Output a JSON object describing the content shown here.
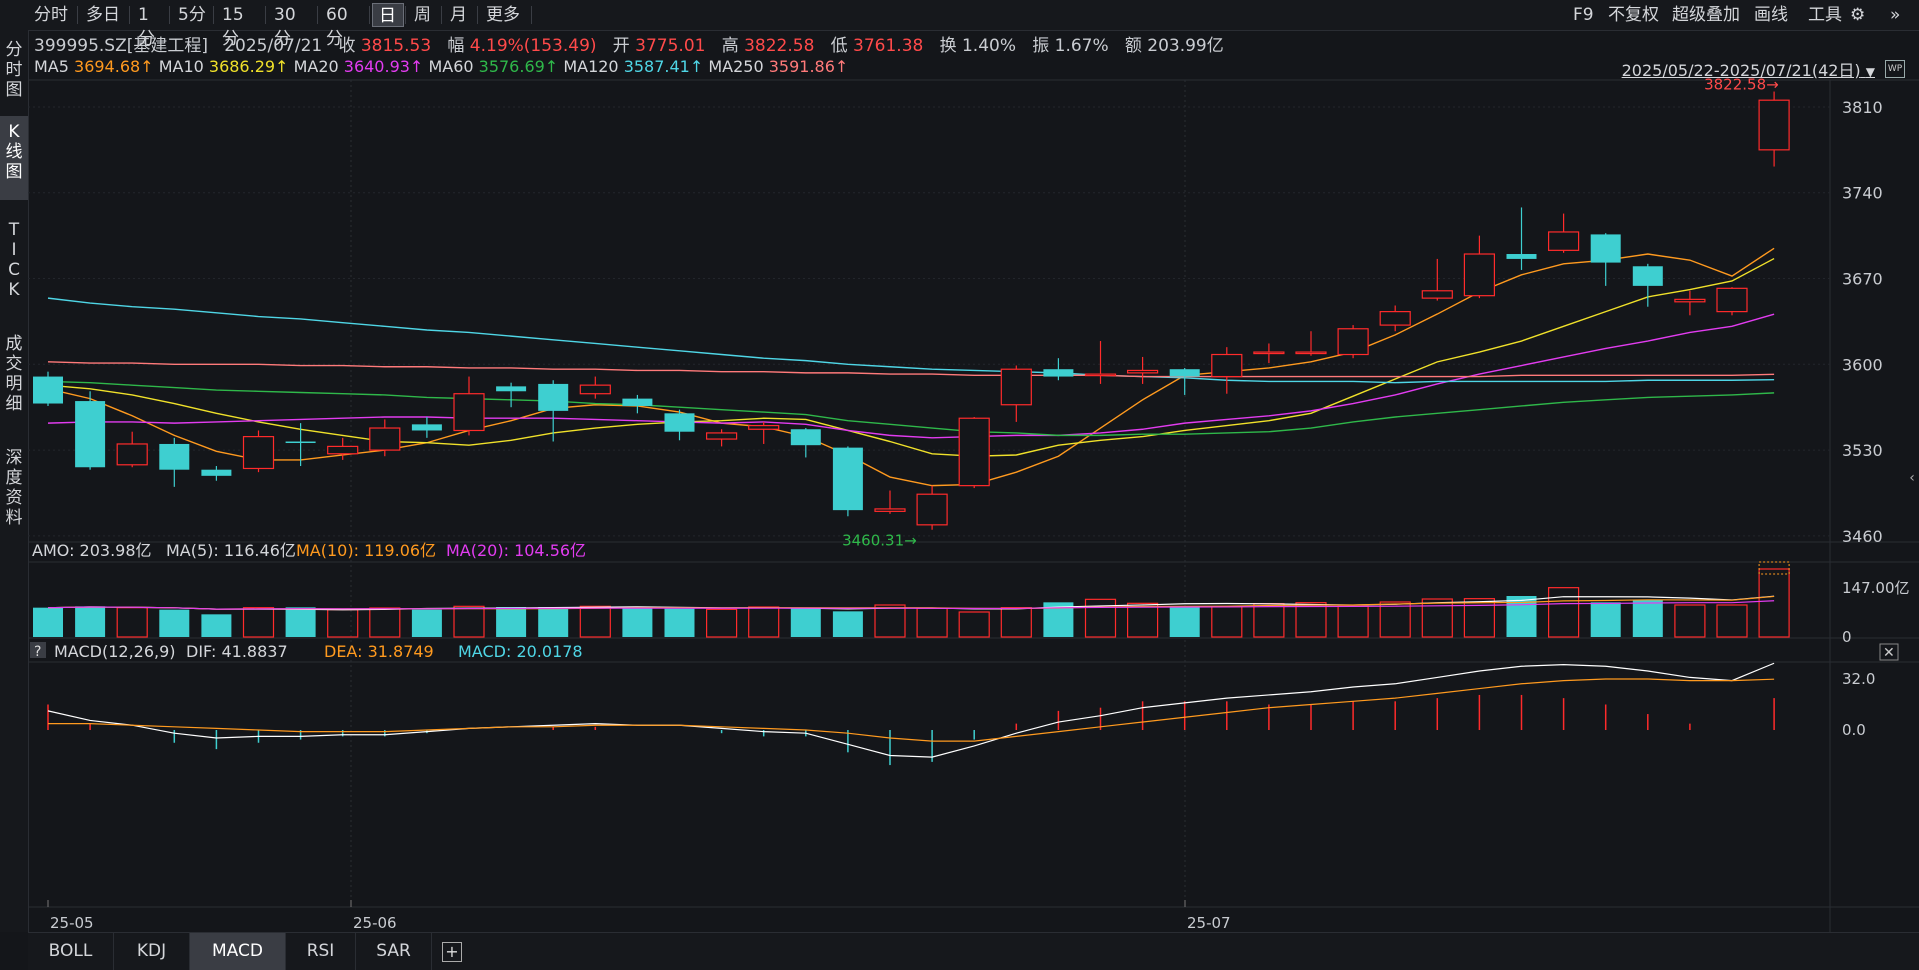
{
  "toolbar": {
    "periods": [
      "分时",
      "多日",
      "1分",
      "5分",
      "15分",
      "30分",
      "60分",
      "日",
      "周",
      "月",
      "更多"
    ],
    "active_period": "日",
    "right_items": [
      "F9",
      "不复权",
      "超级叠加",
      "画线",
      "工具"
    ],
    "settings_icon": "gear-icon",
    "collapse_icon": "double-chevron-right-icon"
  },
  "left_tabs": [
    {
      "label": "分\n时\n图",
      "active": false
    },
    {
      "label": "K\n线\n图",
      "active": true
    },
    {
      "label": "T\nI\nC\nK",
      "active": false
    },
    {
      "label": "成\n交\n明\n细",
      "active": false
    },
    {
      "label": "深\n度\n资\n料",
      "active": false
    }
  ],
  "quote": {
    "code_name": "399995.SZ[基建工程]",
    "date": "2025/07/21",
    "close_label": "收",
    "close": "3815.53",
    "change_label": "幅",
    "change": "4.19%(153.49)",
    "open_label": "开",
    "open": "3775.01",
    "high_label": "高",
    "high": "3822.58",
    "low_label": "低",
    "low": "3761.38",
    "turnover_label": "换",
    "turnover": "1.40%",
    "amplitude_label": "振",
    "amplitude": "1.67%",
    "amount_label": "额",
    "amount": "203.99亿"
  },
  "ma_legend": [
    {
      "name": "MA5",
      "value": "3694.68↑",
      "color": "#ff9a1f"
    },
    {
      "name": "MA10",
      "value": "3686.29↑",
      "color": "#f0e12a"
    },
    {
      "name": "MA20",
      "value": "3640.93↑",
      "color": "#e23cf0"
    },
    {
      "name": "MA60",
      "value": "3576.69↑",
      "color": "#2fb84a"
    },
    {
      "name": "MA120",
      "value": "3587.41↑",
      "color": "#4fd6e6"
    },
    {
      "name": "MA250",
      "value": "3591.86↑",
      "color": "#ff7a7a"
    }
  ],
  "date_range": "2025/05/22-2025/07/21(42日)",
  "chart_data": {
    "type": "candlestick",
    "y_ticks": [
      3810,
      3740,
      3670,
      3600,
      3530,
      3460
    ],
    "max_label": "3822.58",
    "min_label": "3460.31",
    "x_labels": [
      "25-05",
      "25-06",
      "25-07"
    ],
    "colors": {
      "up": "#ff2b2b",
      "down": "#3ecfd0"
    },
    "candles": [
      {
        "o": 3590,
        "c": 3568,
        "h": 3594,
        "l": 3566
      },
      {
        "o": 3570,
        "c": 3516,
        "h": 3578,
        "l": 3514
      },
      {
        "o": 3518,
        "c": 3535,
        "h": 3545,
        "l": 3516
      },
      {
        "o": 3535,
        "c": 3514,
        "h": 3540,
        "l": 3500
      },
      {
        "o": 3514,
        "c": 3509,
        "h": 3517,
        "l": 3505
      },
      {
        "o": 3515,
        "c": 3541,
        "h": 3546,
        "l": 3512
      },
      {
        "o": 3537,
        "c": 3536,
        "h": 3552,
        "l": 3517
      },
      {
        "o": 3527,
        "c": 3533,
        "h": 3540,
        "l": 3522
      },
      {
        "o": 3530,
        "c": 3548,
        "h": 3555,
        "l": 3525
      },
      {
        "o": 3551,
        "c": 3546,
        "h": 3557,
        "l": 3540
      },
      {
        "o": 3546,
        "c": 3576,
        "h": 3590,
        "l": 3542
      },
      {
        "o": 3582,
        "c": 3578,
        "h": 3585,
        "l": 3565
      },
      {
        "o": 3584,
        "c": 3562,
        "h": 3587,
        "l": 3537
      },
      {
        "o": 3576,
        "c": 3583,
        "h": 3590,
        "l": 3572
      },
      {
        "o": 3572,
        "c": 3566,
        "h": 3575,
        "l": 3560
      },
      {
        "o": 3560,
        "c": 3545,
        "h": 3563,
        "l": 3538
      },
      {
        "o": 3539,
        "c": 3544,
        "h": 3547,
        "l": 3533
      },
      {
        "o": 3547,
        "c": 3550,
        "h": 3553,
        "l": 3535
      },
      {
        "o": 3547,
        "c": 3534,
        "h": 3548,
        "l": 3524
      },
      {
        "o": 3532,
        "c": 3481,
        "h": 3533,
        "l": 3476
      },
      {
        "o": 3480,
        "c": 3482,
        "h": 3497,
        "l": 3478
      },
      {
        "o": 3469,
        "c": 3494,
        "h": 3501,
        "l": 3465
      },
      {
        "o": 3501,
        "c": 3556,
        "h": 3557,
        "l": 3499
      },
      {
        "o": 3567,
        "c": 3596,
        "h": 3599,
        "l": 3553
      },
      {
        "o": 3596,
        "c": 3590,
        "h": 3605,
        "l": 3587
      },
      {
        "o": 3592,
        "c": 3592,
        "h": 3619,
        "l": 3584
      },
      {
        "o": 3593,
        "c": 3595,
        "h": 3606,
        "l": 3584
      },
      {
        "o": 3596,
        "c": 3590,
        "h": 3597,
        "l": 3575
      },
      {
        "o": 3590,
        "c": 3608,
        "h": 3614,
        "l": 3576
      },
      {
        "o": 3610,
        "c": 3610,
        "h": 3617,
        "l": 3601
      },
      {
        "o": 3610,
        "c": 3610,
        "h": 3627,
        "l": 3607
      },
      {
        "o": 3608,
        "c": 3629,
        "h": 3632,
        "l": 3605
      },
      {
        "o": 3632,
        "c": 3643,
        "h": 3648,
        "l": 3627
      },
      {
        "o": 3654,
        "c": 3660,
        "h": 3686,
        "l": 3652
      },
      {
        "o": 3656,
        "c": 3690,
        "h": 3705,
        "l": 3654
      },
      {
        "o": 3690,
        "c": 3686,
        "h": 3728,
        "l": 3677
      },
      {
        "o": 3693,
        "c": 3708,
        "h": 3723,
        "l": 3691
      },
      {
        "o": 3706,
        "c": 3683,
        "h": 3707,
        "l": 3664
      },
      {
        "o": 3680,
        "c": 3664,
        "h": 3682,
        "l": 3647
      },
      {
        "o": 3651,
        "c": 3653,
        "h": 3660,
        "l": 3640
      },
      {
        "o": 3643,
        "c": 3662,
        "h": 3663,
        "l": 3640
      },
      {
        "o": 3775,
        "c": 3815.53,
        "h": 3822.58,
        "l": 3761.38
      }
    ],
    "ma_lines": {
      "MA5": [
        3580,
        3572,
        3558,
        3542,
        3529,
        3522,
        3522,
        3526,
        3530,
        3536,
        3546,
        3554,
        3564,
        3567,
        3566,
        3561,
        3552,
        3549,
        3541,
        3526,
        3508,
        3501,
        3502,
        3512,
        3525,
        3548,
        3571,
        3591,
        3594,
        3597,
        3602,
        3610,
        3624,
        3641,
        3659,
        3673,
        3682,
        3685,
        3690,
        3685,
        3672,
        3694.68
      ],
      "MA10": [
        3583,
        3580,
        3575,
        3568,
        3560,
        3553,
        3547,
        3542,
        3537,
        3536,
        3534,
        3538,
        3544,
        3548,
        3551,
        3553,
        3554,
        3556,
        3555,
        3546,
        3537,
        3527,
        3525,
        3526,
        3534,
        3538,
        3541,
        3546,
        3550,
        3554,
        3560,
        3574,
        3588,
        3602,
        3610,
        3619,
        3631,
        3643,
        3655,
        3661,
        3668,
        3686.29
      ],
      "MA20": [
        3552,
        3553,
        3553,
        3552,
        3553,
        3554,
        3555,
        3556,
        3557,
        3557,
        3556,
        3556,
        3556,
        3555,
        3554,
        3553,
        3552,
        3553,
        3551,
        3546,
        3542,
        3540,
        3541,
        3542,
        3542,
        3544,
        3547,
        3552,
        3555,
        3558,
        3562,
        3568,
        3575,
        3584,
        3592,
        3599,
        3606,
        3613,
        3619,
        3626,
        3631,
        3640.93
      ],
      "MA60": [
        3586,
        3585,
        3583,
        3581,
        3579,
        3578,
        3577,
        3576,
        3575,
        3573,
        3572,
        3571,
        3570,
        3568,
        3567,
        3565,
        3563,
        3561,
        3559,
        3554,
        3551,
        3548,
        3545,
        3544,
        3542,
        3542,
        3543,
        3543,
        3544,
        3545,
        3548,
        3553,
        3557,
        3560,
        3563,
        3566,
        3569,
        3571,
        3573,
        3574,
        3575,
        3576.69
      ],
      "MA120": [
        3654,
        3650,
        3647,
        3645,
        3642,
        3639,
        3637,
        3634,
        3631,
        3628,
        3626,
        3623,
        3620,
        3617,
        3614,
        3611,
        3608,
        3605,
        3603,
        3600,
        3598,
        3596,
        3595,
        3594,
        3593,
        3591,
        3590,
        3589,
        3587,
        3586,
        3586,
        3586,
        3585,
        3586,
        3586,
        3586,
        3586,
        3586,
        3587,
        3587,
        3587,
        3587.41
      ],
      "MA250": [
        3602,
        3601,
        3601,
        3600,
        3600,
        3600,
        3599,
        3599,
        3598,
        3598,
        3597,
        3597,
        3596,
        3596,
        3595,
        3595,
        3594,
        3594,
        3593,
        3593,
        3592,
        3592,
        3591,
        3591,
        3591,
        3591,
        3590,
        3590,
        3590,
        3590,
        3590,
        3590,
        3590,
        3590,
        3590,
        3591,
        3591,
        3591,
        3591,
        3591,
        3591,
        3591.86
      ]
    },
    "amo": {
      "legend": [
        {
          "text": "AMO: 203.98亿",
          "color": "#d4d6da"
        },
        {
          "text": "MA(5): 116.46亿",
          "color": "#d4d6da"
        },
        {
          "text": "MA(10): 119.06亿",
          "color": "#ff9a1f"
        },
        {
          "text": "MA(20): 104.56亿",
          "color": "#e23cf0"
        }
      ],
      "y_ticks": [
        "147.00亿",
        "0"
      ],
      "values": [
        88,
        92,
        88,
        82,
        68,
        88,
        89,
        82,
        87,
        82,
        92,
        90,
        90,
        92,
        88,
        85,
        83,
        90,
        87,
        77,
        96,
        86,
        75,
        88,
        104,
        113,
        101,
        93,
        91,
        100,
        103,
        92,
        105,
        114,
        115,
        123,
        148,
        104,
        112,
        96,
        96,
        204
      ]
    },
    "macd": {
      "title": "MACD(12,26,9)",
      "dif_label": "DIF: 41.8837",
      "dea_label": "DEA: 31.8749",
      "macd_label": "MACD: 20.0178",
      "y_ticks": [
        "32.0",
        "0.0"
      ],
      "dif": [
        12,
        6,
        3,
        -2,
        -5,
        -4,
        -4,
        -3,
        -3,
        -1,
        1,
        2,
        3,
        4,
        3,
        3,
        1,
        -1,
        -2,
        -9,
        -16,
        -17,
        -10,
        -2,
        5,
        9,
        14,
        17,
        20,
        22,
        24,
        27,
        29,
        33,
        37,
        40,
        41,
        40,
        37,
        33,
        31,
        41.88
      ],
      "dea": [
        4,
        4,
        3,
        2,
        1,
        0,
        -1,
        -1,
        -1,
        0,
        1,
        2,
        2,
        3,
        3,
        3,
        2,
        1,
        0,
        -2,
        -5,
        -7,
        -7,
        -4,
        -1,
        2,
        5,
        8,
        11,
        14,
        16,
        18,
        20,
        23,
        26,
        29,
        31,
        32,
        32,
        31,
        31,
        31.87
      ]
    }
  }
}
